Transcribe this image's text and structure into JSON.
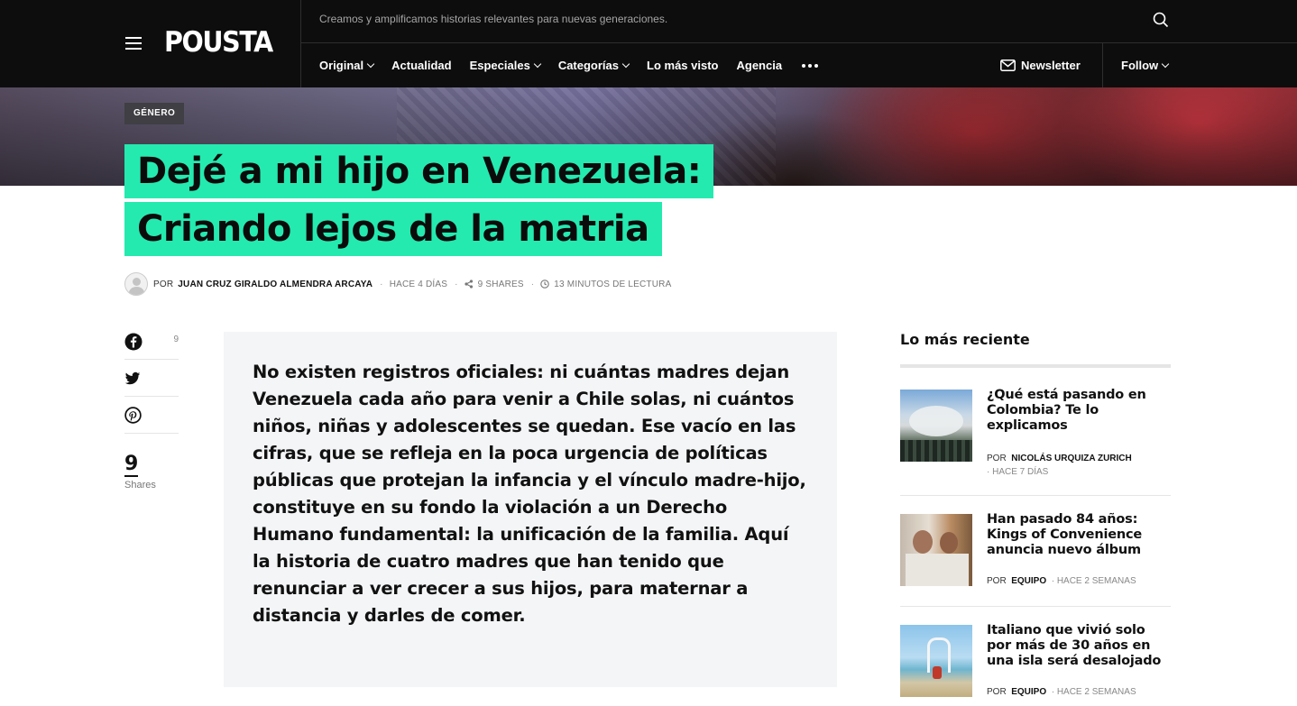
{
  "site": {
    "logo": "POUSTA",
    "tagline": "Creamos y amplificamos historias relevantes para nuevas generaciones."
  },
  "nav": {
    "items": [
      {
        "label": "Original",
        "dropdown": true
      },
      {
        "label": "Actualidad",
        "dropdown": false
      },
      {
        "label": "Especiales",
        "dropdown": true
      },
      {
        "label": "Categorías",
        "dropdown": true
      },
      {
        "label": "Lo más visto",
        "dropdown": false
      },
      {
        "label": "Agencia",
        "dropdown": false
      }
    ],
    "newsletter_label": "Newsletter",
    "follow_label": "Follow"
  },
  "article": {
    "category": "GÉNERO",
    "title_line1": "Dejé a mi hijo en Venezuela:",
    "title_line2": "Criando lejos de la matria",
    "meta": {
      "by": "POR",
      "author": "JUAN CRUZ GIRALDO ALMENDRA ARCAYA",
      "time": "HACE 4 DÍAS",
      "shares": "9 SHARES",
      "reading": "13 MINUTOS DE LECTURA"
    },
    "lead": "No existen registros oficiales: ni cuántas madres dejan Venezuela cada año para venir a Chile solas, ni cuántos niños, niñas y adolescentes se quedan. Ese vacío en las cifras, que se refleja en la poca urgencia de políticas públicas que protejan la infancia y el vínculo madre-hijo, constituye en su fondo la violación a un Derecho Humano fundamental: la unificación de la familia. Aquí la historia de cuatro madres que han tenido que renunciar a ver crecer a sus hijos,  para maternar a distancia y darles de comer."
  },
  "share": {
    "facebook_count": "9",
    "total": "9",
    "total_label": "Shares"
  },
  "sidebar": {
    "title": "Lo más reciente",
    "posts": [
      {
        "title": "¿Qué está pasando en Colombia? Te lo explicamos",
        "by": "POR",
        "author": "NICOLÁS URQUIZA ZURICH",
        "time": "HACE 7 DÍAS"
      },
      {
        "title": "Han pasado 84 años: Kings of Convenience anuncia nuevo álbum",
        "by": "POR",
        "author": "EQUIPO",
        "time": "HACE 2 SEMANAS"
      },
      {
        "title": "Italiano que vivió solo por más de 30 años en una isla será desalojado",
        "by": "POR",
        "author": "EQUIPO",
        "time": "HACE 2 SEMANAS"
      }
    ]
  },
  "colors": {
    "header_bg": "#0d0d0d",
    "title_highlight": "#24eab0",
    "badge_bg": "#3f3f44",
    "lead_bg": "#f4f5f7"
  },
  "icons": {
    "menu": "hamburger-icon",
    "search": "search-icon",
    "more": "more-dots-icon",
    "newsletter": "envelope-icon",
    "facebook": "facebook-icon",
    "twitter": "twitter-icon",
    "pinterest": "pinterest-icon"
  }
}
